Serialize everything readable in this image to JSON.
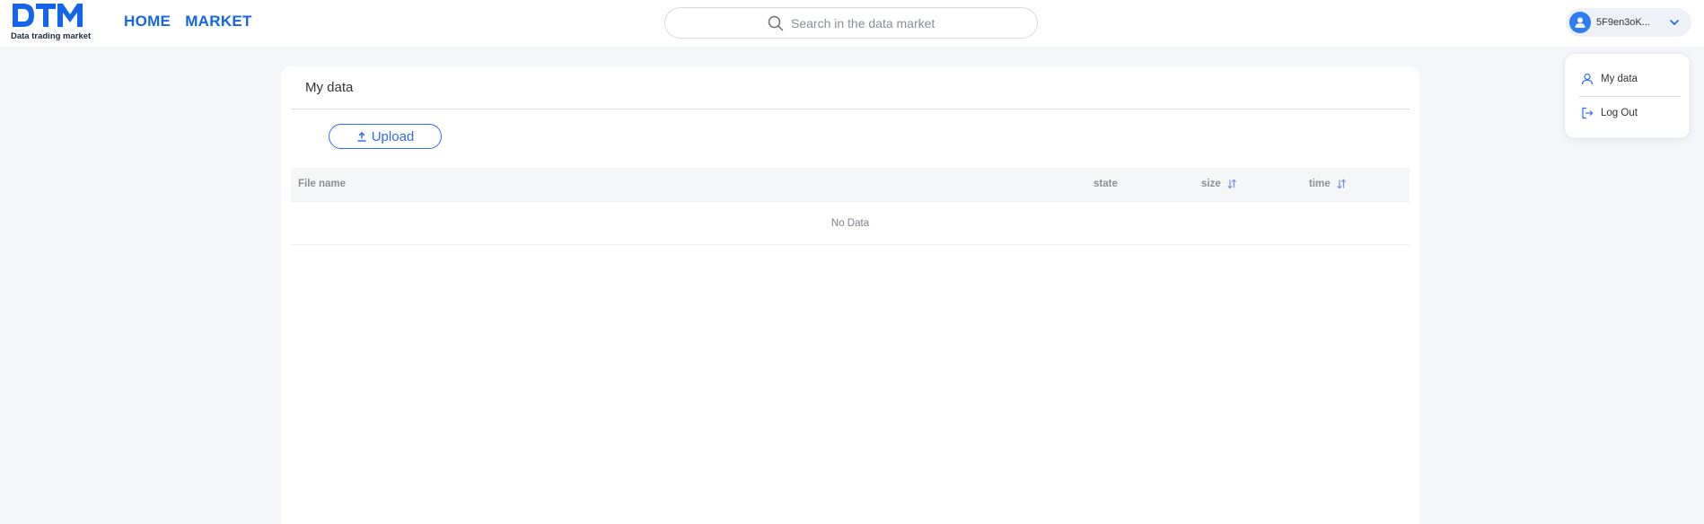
{
  "header": {
    "logo_text": "DTM",
    "logo_subtitle": "Data trading market",
    "nav": [
      {
        "label": "HOME"
      },
      {
        "label": "MARKET"
      }
    ],
    "search": {
      "placeholder": "Search in the data market",
      "icon": "search-icon"
    },
    "user": {
      "name": "5F9en3oK...",
      "avatar_color": "#2f7cf6",
      "icon": "chevron-down-icon"
    }
  },
  "user_menu": {
    "items": [
      {
        "label": "My data",
        "icon": "user-icon"
      },
      {
        "label": "Log Out",
        "icon": "logout-icon"
      }
    ]
  },
  "main": {
    "title": "My data",
    "upload_label": "Upload",
    "table": {
      "columns": [
        {
          "label": "File name",
          "sortable": false
        },
        {
          "label": "state",
          "sortable": false
        },
        {
          "label": "size",
          "sortable": true
        },
        {
          "label": "time",
          "sortable": true
        }
      ],
      "empty_text": "No Data"
    }
  },
  "colors": {
    "brand": "#1565e8",
    "accent": "#2d6cf0",
    "background": "#f4f6f9"
  }
}
